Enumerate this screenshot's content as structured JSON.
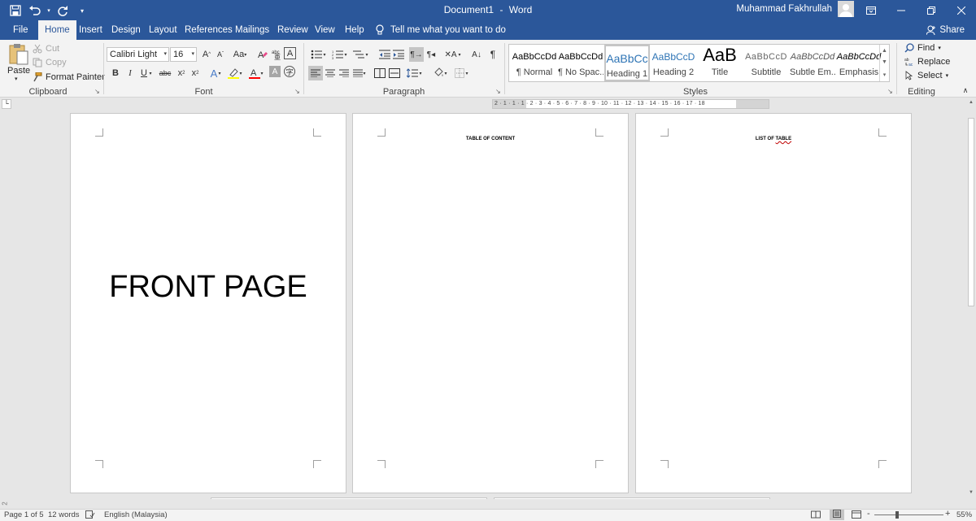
{
  "window": {
    "doc_title": "Document1",
    "title_separator": "-",
    "app_name": "Word",
    "user_name": "Muhammad Fakhrullah"
  },
  "tabs": [
    {
      "label": "File"
    },
    {
      "label": "Home"
    },
    {
      "label": "Insert"
    },
    {
      "label": "Design"
    },
    {
      "label": "Layout"
    },
    {
      "label": "References"
    },
    {
      "label": "Mailings"
    },
    {
      "label": "Review"
    },
    {
      "label": "View"
    },
    {
      "label": "Help"
    }
  ],
  "tell_me": "Tell me what you want to do",
  "share_label": "Share",
  "clipboard": {
    "paste": "Paste",
    "cut": "Cut",
    "copy": "Copy",
    "format_painter": "Format Painter",
    "group_label": "Clipboard"
  },
  "font": {
    "font_name": "Calibri Light (He",
    "font_size": "16",
    "group_label": "Font"
  },
  "paragraph": {
    "group_label": "Paragraph"
  },
  "styles": {
    "items": [
      {
        "preview": "AaBbCcDd",
        "name": "¶ Normal"
      },
      {
        "preview": "AaBbCcDd",
        "name": "¶ No Spac..."
      },
      {
        "preview": "AaBbCc",
        "name": "Heading 1"
      },
      {
        "preview": "AaBbCcD",
        "name": "Heading 2"
      },
      {
        "preview": "AaB",
        "name": "Title"
      },
      {
        "preview": "AaBbCcD",
        "name": "Subtitle"
      },
      {
        "preview": "AaBbCcDd",
        "name": "Subtle Em..."
      },
      {
        "preview": "AaBbCcDd",
        "name": "Emphasis"
      }
    ],
    "group_label": "Styles"
  },
  "editing": {
    "find": "Find",
    "replace": "Replace",
    "select": "Select",
    "group_label": "Editing"
  },
  "ruler_text": "2 · 1 · 1 · 1 · 2 · 3 · 4 · 5 · 6 · 7 · 8 · 9 · 10 · 11 · 12 · 13 · 14 · 15 · 16 · 17 · 18",
  "pages": {
    "front_text": "FRONT PAGE",
    "toc_heading": "TABLE OF CONTENT",
    "list_heading_part1": "LIST OF ",
    "list_heading_part2": "TABLE"
  },
  "status": {
    "page": "Page 1 of 5",
    "words": "12 words",
    "language": "English (Malaysia)",
    "zoom_minus": "-",
    "zoom_plus": "+",
    "zoom": "55%",
    "side_number": "2"
  },
  "colors": {
    "title_bar": "#2b579a",
    "ribbon": "#f3f3f3",
    "workspace": "#e6e6e6",
    "font_color_swatch": "#ff0000",
    "highlight_swatch": "#ffff00"
  }
}
